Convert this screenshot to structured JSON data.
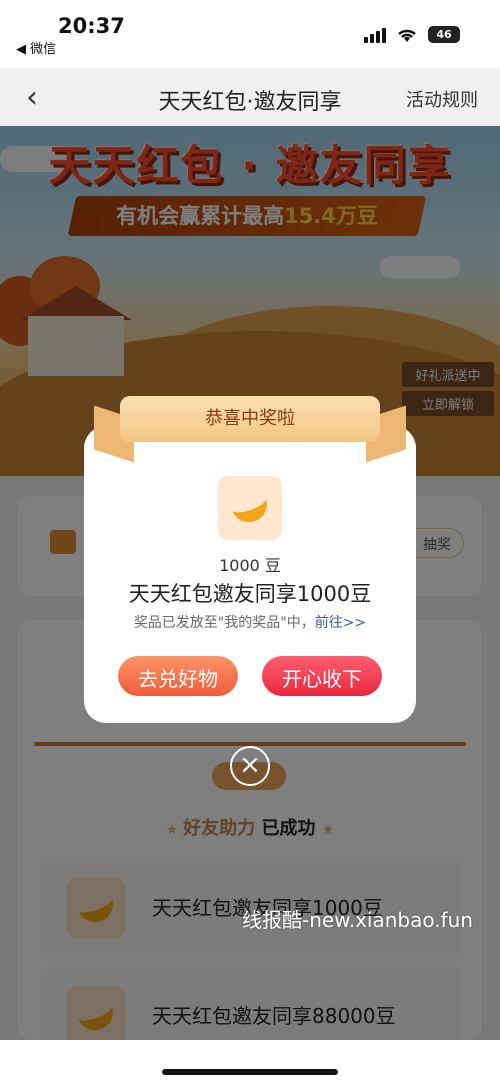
{
  "status_bar": {
    "time": "20:37",
    "back_app": "◀ 微信",
    "battery": "46"
  },
  "nav": {
    "back": "‹",
    "title": "天天红包·邀友同享",
    "rules": "活动规则"
  },
  "banner": {
    "title": "天天红包 · 邀友同享",
    "subtitle_prefix": "有机会赢累计最高",
    "subtitle_value": "15.4万豆",
    "sign_top": "好礼派送中",
    "sign_bottom": "立即解锁"
  },
  "page": {
    "lottery_button": "抽奖",
    "friends_label": "好友助力",
    "friends_status": "已成功",
    "prizes": [
      {
        "name": "天天红包邀友同享1000豆"
      },
      {
        "name": "天天红包邀友同享88000豆"
      }
    ]
  },
  "modal": {
    "ribbon": "恭喜中奖啦",
    "quantity": "1000 豆",
    "title": "天天红包邀友同享1000豆",
    "note": "奖品已发放至\"我的奖品\"中，",
    "note_link": "前往>>",
    "btn_exchange": "去兑好物",
    "btn_accept": "开心收下",
    "close": "×"
  },
  "watermark": "线报酷-new.xianbao.fun",
  "colors": {
    "accent_red": "#e8293f",
    "accent_orange": "#ef5b3b",
    "link": "#3a5cc7"
  }
}
